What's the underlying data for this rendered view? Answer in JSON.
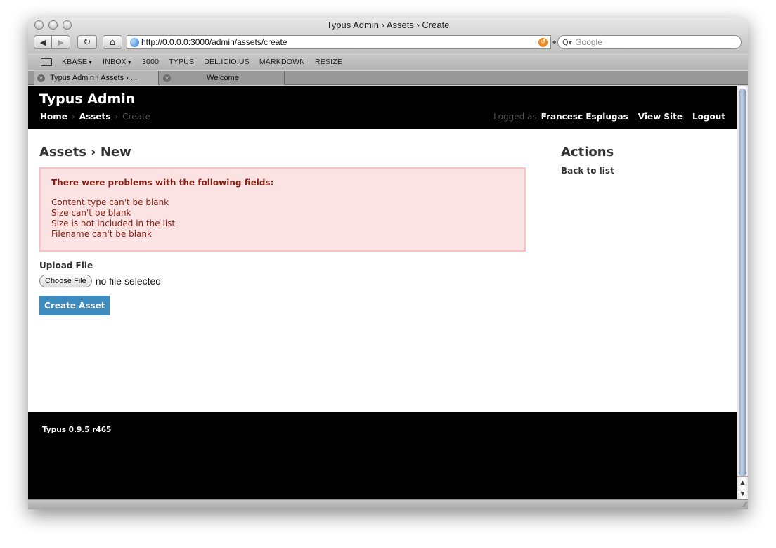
{
  "window": {
    "title": "Typus Admin › Assets › Create"
  },
  "toolbar": {
    "back_glyph": "◀",
    "forward_glyph": "▶",
    "reload_glyph": "↻",
    "home_glyph": "⌂",
    "url": "http://0.0.0.0:3000/admin/assets/create",
    "search_placeholder": "Google",
    "search_glyph": "Q▾"
  },
  "bookmarks": [
    {
      "label": "KBASE",
      "menu": true
    },
    {
      "label": "INBOX",
      "menu": true
    },
    {
      "label": "3000",
      "menu": false
    },
    {
      "label": "TYPUS",
      "menu": false
    },
    {
      "label": "DEL.ICIO.US",
      "menu": false
    },
    {
      "label": "MARKDOWN",
      "menu": false
    },
    {
      "label": "RESIZE",
      "menu": false
    }
  ],
  "tabs": [
    {
      "label": "Typus Admin › Assets › ..."
    },
    {
      "label": "Welcome"
    }
  ],
  "header": {
    "app_title": "Typus Admin",
    "breadcrumb": {
      "home": "Home",
      "assets": "Assets",
      "current": "Create",
      "sep": "›"
    },
    "logged_as": "Logged as",
    "user_name": "Francesc Esplugas",
    "view_site": "View Site",
    "logout": "Logout"
  },
  "main": {
    "page_title": "Assets › New",
    "errors": {
      "heading": "There were problems with the following fields:",
      "items": [
        "Content type can't be blank",
        "Size can't be blank",
        "Size is not included in the list",
        "Filename can't be blank"
      ]
    },
    "upload_label": "Upload File",
    "choose_file": "Choose File",
    "file_status": "no file selected",
    "submit": "Create Asset"
  },
  "sidebar": {
    "title": "Actions",
    "back_link": "Back to list"
  },
  "footer": {
    "version": "Typus 0.9.5 r465"
  },
  "colors": {
    "header_bg": "#000000",
    "error_bg": "#fbe3e4",
    "error_text": "#8a1f11",
    "button_bg": "#3d8bbf"
  }
}
